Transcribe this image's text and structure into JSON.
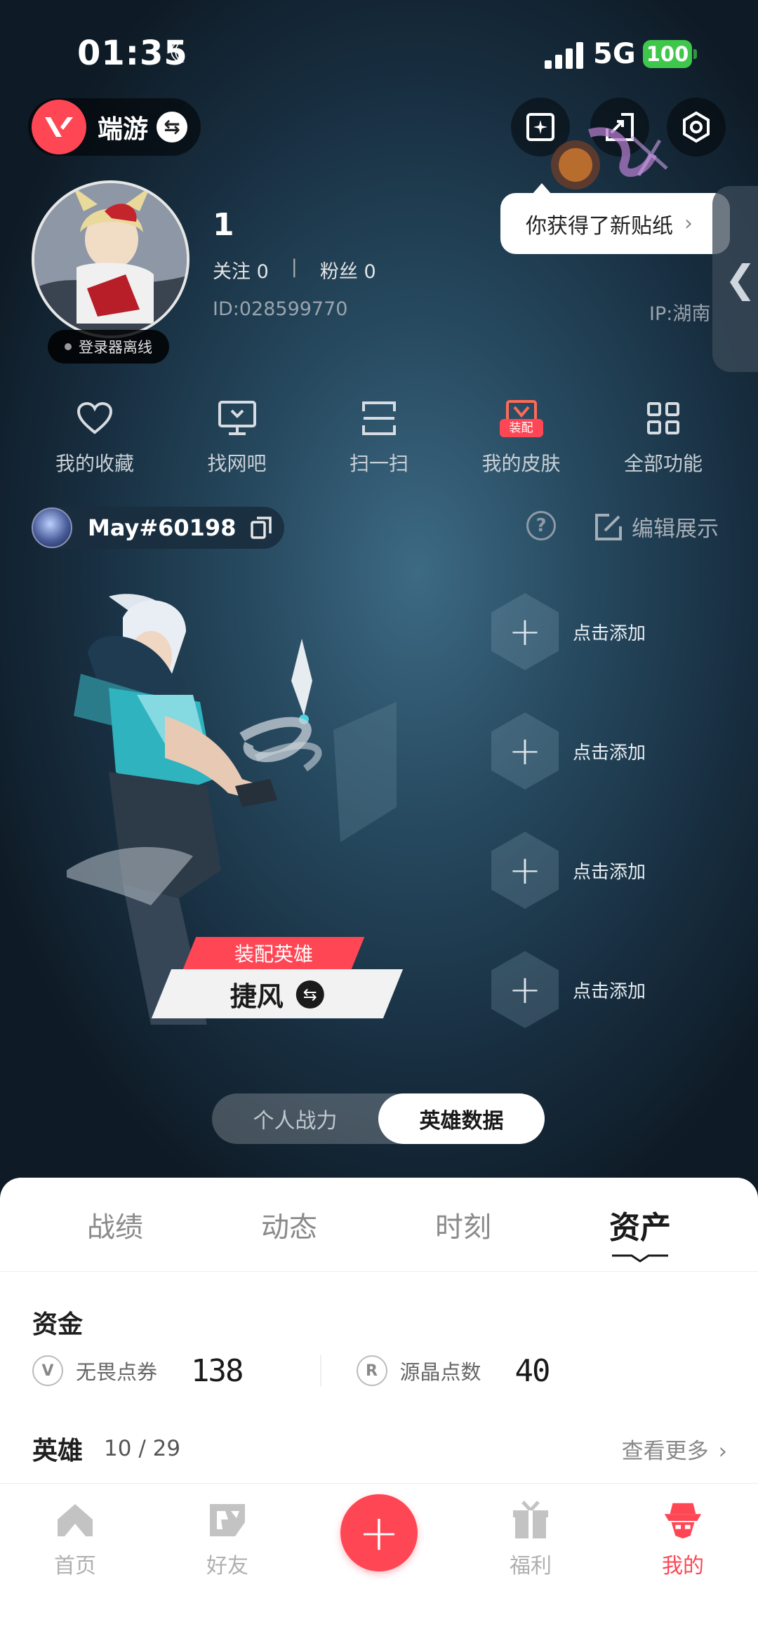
{
  "status_bar": {
    "time": "01:35",
    "network": "5G",
    "battery": "100"
  },
  "mode_switch": {
    "label": "端游"
  },
  "sticker_tip": {
    "text": "你获得了新贴纸"
  },
  "profile": {
    "username": "1",
    "following_label": "关注",
    "following_count": "0",
    "followers_label": "粉丝",
    "followers_count": "0",
    "id_text": "ID:028599770",
    "ip_text": "IP:湖南",
    "login_status": "登录器离线"
  },
  "quick_actions": [
    {
      "label": "我的收藏",
      "icon": "heart-icon"
    },
    {
      "label": "找网吧",
      "icon": "monitor-icon"
    },
    {
      "label": "扫一扫",
      "icon": "scan-icon"
    },
    {
      "label": "我的皮肤",
      "icon": "skin-icon",
      "badge": "装配"
    },
    {
      "label": "全部功能",
      "icon": "grid-icon"
    }
  ],
  "riot_account": {
    "name": "May#60198"
  },
  "edit_display": {
    "label": "编辑展示"
  },
  "equipped_agent": {
    "tag": "装配英雄",
    "name": "捷风"
  },
  "slots": [
    {
      "label": "点击添加"
    },
    {
      "label": "点击添加"
    },
    {
      "label": "点击添加"
    },
    {
      "label": "点击添加"
    }
  ],
  "segment": {
    "options": [
      "个人战力",
      "英雄数据"
    ],
    "active": "英雄数据"
  },
  "tabs": [
    {
      "label": "战绩"
    },
    {
      "label": "动态"
    },
    {
      "label": "时刻"
    },
    {
      "label": "资产"
    }
  ],
  "active_tab": "资产",
  "funds": {
    "title": "资金",
    "items": [
      {
        "label": "无畏点券",
        "value": "138",
        "icon": "vp-coin-icon"
      },
      {
        "label": "源晶点数",
        "value": "40",
        "icon": "radianite-icon"
      }
    ]
  },
  "heroes": {
    "title": "英雄",
    "count": "10 / 29",
    "more_label": "查看更多"
  },
  "bottom_nav": [
    {
      "label": "首页",
      "icon": "home-icon"
    },
    {
      "label": "好友",
      "icon": "friends-icon"
    },
    {
      "label": "福利",
      "icon": "gift-icon"
    },
    {
      "label": "我的",
      "icon": "me-icon"
    }
  ],
  "colors": {
    "accent": "#ff4655",
    "battery": "#3ec74a",
    "background": "#0f1b26"
  }
}
